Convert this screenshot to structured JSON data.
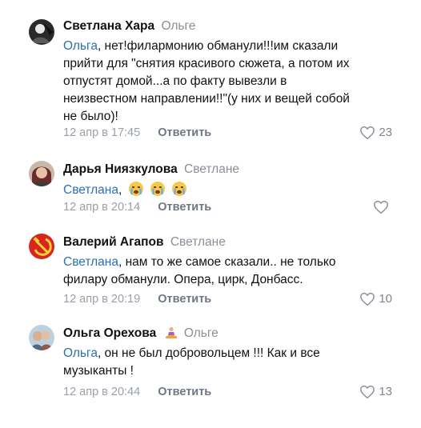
{
  "comments": [
    {
      "author": "Светлана Хара",
      "reply_to": "Ольге",
      "mention": "Ольга",
      "text_lines": [
        ", нет!филармонию обманули!!!им сказали",
        "прийти для \"снятия красивого сюжета, а потом их",
        "отпустят домой...а по факту вывезли в",
        "неизвестном направлении!!\"(у них и вещей собой",
        "не было)!"
      ],
      "date": "12 апр в 17:45",
      "reply_label": "Ответить",
      "likes": "23",
      "avatar_icon": "avatar-dark-profile-icon"
    },
    {
      "author": "Дарья Ниязкулова",
      "reply_to": "Светлане",
      "mention": "Светлана",
      "text_lines": [
        ","
      ],
      "emojis": [
        "crying-face-emoji",
        "crying-face-emoji",
        "crying-face-emoji"
      ],
      "date": "12 апр в 20:14",
      "reply_label": "Ответить",
      "likes": "",
      "avatar_icon": "avatar-profile-photo-icon"
    },
    {
      "author": "Валерий Агапов",
      "reply_to": "Светлане",
      "mention": "Светлана",
      "text_lines": [
        ", нам то же самое сказали.. не только",
        "филару обманули. Опера, цирк, Донбасс."
      ],
      "date": "12 апр в 20:19",
      "reply_label": "Ответить",
      "likes": "10",
      "avatar_icon": "hammer-sickle-avatar-icon"
    },
    {
      "author": "Ольга Орехова",
      "reply_to": "Ольге",
      "mention": "Ольга",
      "text_lines": [
        ", он не был добровольцем !!! Как и все",
        "музыканты !"
      ],
      "date": "12 апр в 20:44",
      "reply_label": "Ответить",
      "likes": "13",
      "avatar_icon": "avatar-profile-photo-icon",
      "author_badge_icon": "meditation-emoji-icon"
    }
  ],
  "colors": {
    "mention": "#2a6fb8",
    "muted": "#9aa0a8",
    "action": "#6f7782",
    "emoji_face": "#f7c948"
  }
}
